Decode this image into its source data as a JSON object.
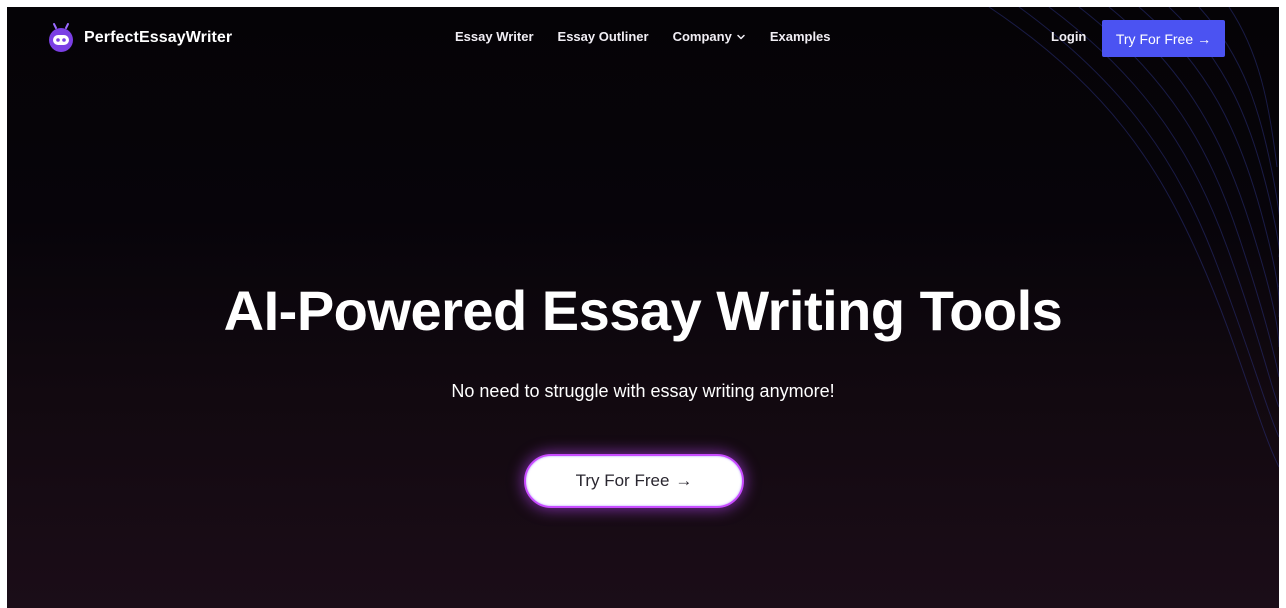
{
  "brand": {
    "name": "PerfectEssayWriter",
    "logo_icon": "robot-head-icon",
    "accent_color": "#7b3fe4"
  },
  "nav": {
    "links": [
      {
        "label": "Essay Writer"
      },
      {
        "label": "Essay Outliner"
      },
      {
        "label": "Company",
        "has_dropdown": true
      },
      {
        "label": "Examples"
      }
    ],
    "login_label": "Login",
    "cta_label": "Try For Free",
    "cta_color": "#4b53f2"
  },
  "hero": {
    "title": "AI-Powered Essay Writing Tools",
    "subtitle": "No need to struggle with essay writing anymore!",
    "cta_label": "Try For Free",
    "cta_border_color": "#c84cff"
  },
  "colors": {
    "background_top": "#050306",
    "background_bottom": "#1b0d18",
    "wave_lines": "#2a2f7a"
  }
}
